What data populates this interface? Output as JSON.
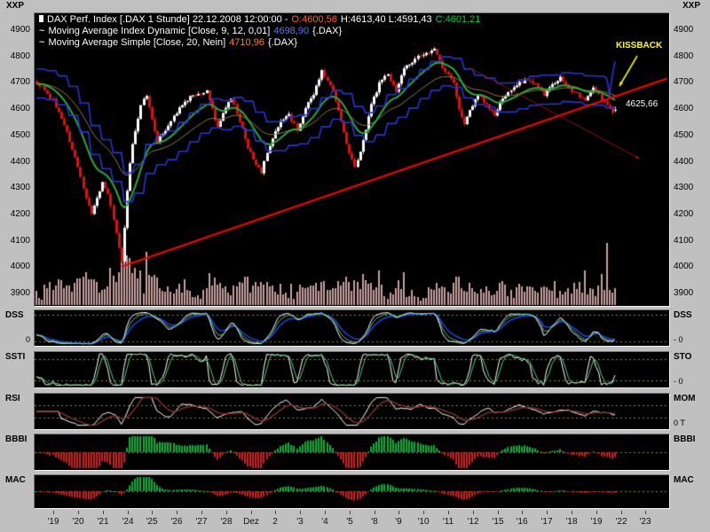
{
  "window": {
    "corner_left": "XXP",
    "corner_right": "XXP"
  },
  "header": {
    "line1": {
      "icon": "candle-icon",
      "title": "DAX Perf. Index [.DAX 1 Stunde] 22.12.2008 12:00:00 -",
      "open": "O:4600,56",
      "high_low": "H:4613,40 L:4591,43",
      "close": "C:4601,21"
    },
    "line2": {
      "icon": "wave-icon",
      "icon_char": "~",
      "label": "Moving Average Index Dynamic [Close, 9, 12, 0,01]",
      "value": "4698,90",
      "suffix": "{.DAX}"
    },
    "line3": {
      "icon": "wave-icon",
      "icon_char": "~",
      "label": "Moving Average Simple [Close, 20, Nein]",
      "value": "4710,96",
      "suffix": "{.DAX}"
    }
  },
  "annotations": {
    "kissback_label": "KISSBACK",
    "price_label": "4625,66"
  },
  "price_axis": {
    "labels": [
      "4900",
      "4800",
      "4700",
      "4600",
      "4500",
      "4400",
      "4300",
      "4200",
      "4100",
      "4000",
      "3900"
    ]
  },
  "x_axis": {
    "labels": [
      "'19",
      "'20",
      "'21",
      "'24",
      "'25",
      "'26",
      "'27",
      "'28",
      "Dez",
      "2",
      "'3",
      "'4",
      "'5",
      "'8",
      "'9",
      "'10",
      "'11",
      "'12",
      "'15",
      "'16",
      "'17",
      "'18",
      "'19",
      "'22",
      "'23"
    ],
    "bars_per_day": 9
  },
  "panels": [
    {
      "key": "dss",
      "left": "DSS",
      "right": "DSS",
      "left_tick": "0",
      "right_tick": "- 0"
    },
    {
      "key": "sto",
      "left": "SSTI",
      "right": "STO",
      "left_tick": "",
      "right_tick": "- 0"
    },
    {
      "key": "mom",
      "left": "RSI",
      "right": "MOM",
      "left_tick": "",
      "right_tick": "0 T"
    },
    {
      "key": "bbbi",
      "left": "BBBI",
      "right": "BBBI",
      "left_tick": "",
      "right_tick": ""
    },
    {
      "key": "mac",
      "left": "MAC",
      "right": "MAC",
      "left_tick": "",
      "right_tick": ""
    }
  ],
  "colors": {
    "frame_bg": "#c0c0c0",
    "chart_bg": "#000000",
    "candle_up": "#ffffff",
    "candle_down": "#dd1111",
    "volume": "#c79f9f",
    "ma_green": "#2baa3c",
    "ma_olive": "#8f7f3f",
    "band_blue": "#2636d4",
    "trend_red": "#ff0000",
    "resist_red": "#991111",
    "kissback_yellow": "#ffff00",
    "open_orange": "#ff6600",
    "close_green": "#00cc44",
    "value_blue": "#5577ff",
    "value_orange": "#ff8800",
    "dss_blue": "#2040dd",
    "osc_white": "#ffffff",
    "osc_green": "#55cc77",
    "mom_red": "#8b3030",
    "hist_green": "#00b33c",
    "hist_red": "#cc2020",
    "dotted_olive": "#8a8a20"
  },
  "chart_data": {
    "type": "candlestick",
    "title": "DAX Perf. Index",
    "symbol": ".DAX",
    "interval": "1 Stunde",
    "last_bar": {
      "date": "22.12.2008",
      "time": "12:00:00",
      "open": 4600.56,
      "high": 4613.4,
      "low": 4591.43,
      "close": 4601.21
    },
    "overlays": [
      {
        "name": "Moving Average Index Dynamic",
        "params": "Close, 9, 12, 0,01",
        "value": 4698.9
      },
      {
        "name": "Moving Average Simple",
        "params": "Close, 20, Nein",
        "value": 4710.96
      }
    ],
    "ylim": [
      3900,
      4900
    ],
    "bars_per_day": 9,
    "sessions": [
      "19.11",
      "20.11",
      "21.11",
      "24.11",
      "25.11",
      "26.11",
      "27.11",
      "28.11",
      "01.12",
      "02.12",
      "03.12",
      "04.12",
      "05.12",
      "08.12",
      "09.12",
      "10.12",
      "11.12",
      "12.12",
      "15.12",
      "16.12",
      "17.12",
      "18.12",
      "19.12",
      "22.12"
    ],
    "close_anchors": [
      [
        0,
        4700
      ],
      [
        3,
        4675
      ],
      [
        6,
        4635
      ],
      [
        8,
        4595
      ],
      [
        10,
        4545
      ],
      [
        13,
        4450
      ],
      [
        16,
        4345
      ],
      [
        18,
        4265
      ],
      [
        20,
        4205
      ],
      [
        22,
        4260
      ],
      [
        24,
        4330
      ],
      [
        26,
        4285
      ],
      [
        28,
        4185
      ],
      [
        30,
        4080
      ],
      [
        31,
        4020
      ],
      [
        32,
        4150
      ],
      [
        33,
        4290
      ],
      [
        34,
        4400
      ],
      [
        35,
        4470
      ],
      [
        36,
        4520
      ],
      [
        38,
        4620
      ],
      [
        40,
        4655
      ],
      [
        42,
        4560
      ],
      [
        44,
        4485
      ],
      [
        46,
        4505
      ],
      [
        49,
        4560
      ],
      [
        53,
        4620
      ],
      [
        56,
        4650
      ],
      [
        60,
        4660
      ],
      [
        62,
        4670
      ],
      [
        64,
        4600
      ],
      [
        66,
        4530
      ],
      [
        68,
        4590
      ],
      [
        71,
        4650
      ],
      [
        74,
        4560
      ],
      [
        77,
        4460
      ],
      [
        80,
        4395
      ],
      [
        82,
        4365
      ],
      [
        85,
        4470
      ],
      [
        89,
        4560
      ],
      [
        92,
        4580
      ],
      [
        95,
        4525
      ],
      [
        98,
        4610
      ],
      [
        101,
        4660
      ],
      [
        104,
        4745
      ],
      [
        107,
        4700
      ],
      [
        110,
        4600
      ],
      [
        113,
        4470
      ],
      [
        116,
        4380
      ],
      [
        119,
        4480
      ],
      [
        122,
        4620
      ],
      [
        125,
        4700
      ],
      [
        128,
        4740
      ],
      [
        131,
        4665
      ],
      [
        134,
        4760
      ],
      [
        136,
        4770
      ],
      [
        139,
        4800
      ],
      [
        143,
        4820
      ],
      [
        145,
        4830
      ],
      [
        148,
        4760
      ],
      [
        152,
        4700
      ],
      [
        154,
        4600
      ],
      [
        156,
        4550
      ],
      [
        159,
        4620
      ],
      [
        161,
        4660
      ],
      [
        164,
        4620
      ],
      [
        167,
        4580
      ],
      [
        170,
        4650
      ],
      [
        173,
        4670
      ],
      [
        176,
        4700
      ],
      [
        179,
        4720
      ],
      [
        182,
        4700
      ],
      [
        185,
        4660
      ],
      [
        188,
        4700
      ],
      [
        191,
        4720
      ],
      [
        194,
        4680
      ],
      [
        197,
        4660
      ],
      [
        200,
        4640
      ],
      [
        203,
        4690
      ],
      [
        206,
        4640
      ],
      [
        208,
        4620
      ],
      [
        210,
        4596
      ],
      [
        211,
        4601
      ]
    ],
    "trendline_support": {
      "from": [
        31,
        4005
      ],
      "to": [
        230,
        4720
      ],
      "color": "#ff0000"
    },
    "trendline_resistance": {
      "from": [
        158,
        4760
      ],
      "to": [
        220,
        4415
      ],
      "color": "#991111"
    },
    "kissback_price": 4625.66,
    "volume_spikes": {
      "30": 0.5,
      "31": 0.7,
      "33": 0.55,
      "36": 0.6,
      "38": 0.55,
      "40": 0.85,
      "76": 0.3,
      "110": 0.35,
      "116": 0.4,
      "125": 0.3,
      "152": 0.35,
      "176": 0.3,
      "196": 0.35,
      "200": 0.55,
      "206": 0.5,
      "208": 1.0
    },
    "indicator_panels": [
      "DSS",
      "STO",
      "MOM",
      "BBBI",
      "MAC"
    ]
  }
}
